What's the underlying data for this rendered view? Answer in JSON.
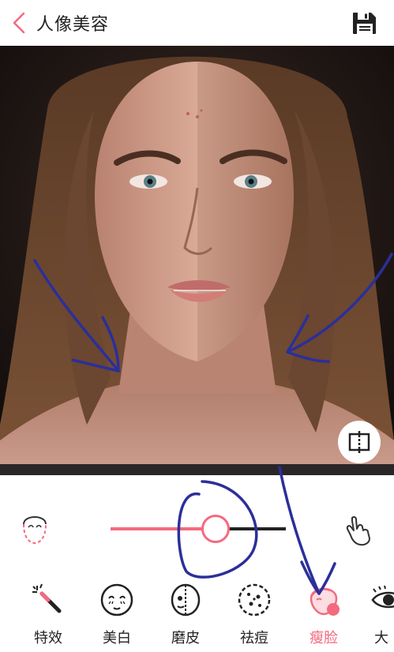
{
  "header": {
    "title": "人像美容",
    "back_icon": "chevron-left-icon",
    "save_icon": "save-icon"
  },
  "photo": {
    "compare_icon": "compare-split-icon"
  },
  "adjust": {
    "left_icon": "face-outline-icon",
    "right_icon": "hand-pointer-icon",
    "slider_value": 0.6
  },
  "toolbar": {
    "tools": [
      {
        "label": "特效",
        "icon": "magic-wand-icon"
      },
      {
        "label": "美白",
        "icon": "face-whiten-icon"
      },
      {
        "label": "磨皮",
        "icon": "face-smooth-icon"
      },
      {
        "label": "祛痘",
        "icon": "face-acne-icon"
      },
      {
        "label": "瘦脸",
        "icon": "face-slim-icon"
      },
      {
        "label": "大",
        "icon": "eye-icon"
      }
    ],
    "active_index": 4
  },
  "colors": {
    "accent": "#f46a7f",
    "annotation": "#2b2f9a",
    "text": "#222222"
  }
}
